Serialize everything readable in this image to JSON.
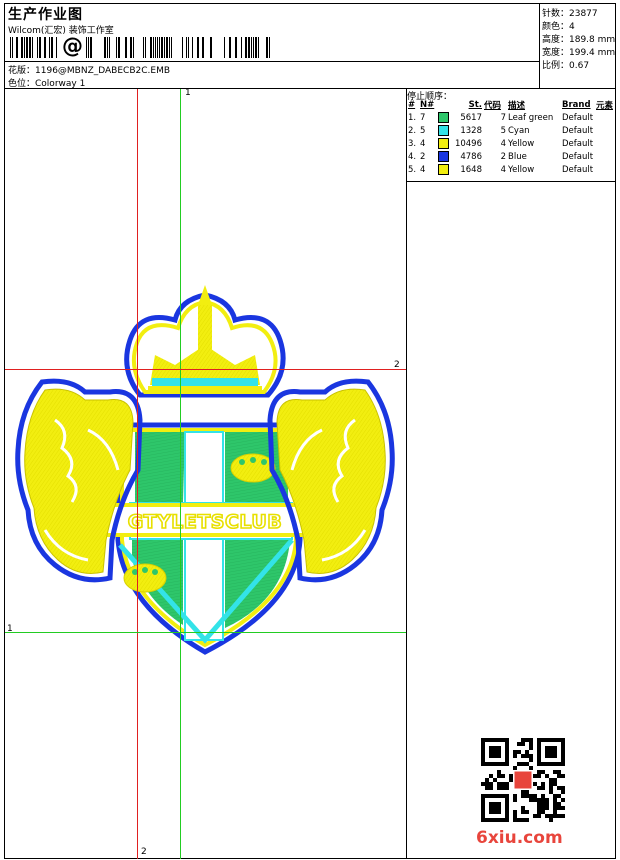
{
  "header": {
    "title": "生产作业图",
    "subtitle": "Wilcom(汇宏) 装饰工作室",
    "barcode_char": "@",
    "design_label": "花版：",
    "design_file": "1196@MBNZ_DABECB2C.EMB",
    "colorway_label": "色位：",
    "colorway": "Colorway 1"
  },
  "stats": {
    "stitches": "针数：23877",
    "colors": "颜色：4",
    "height": "高度：189.8 mm",
    "width": "宽度：199.4 mm",
    "scale": "比例：0.67"
  },
  "stops": {
    "title": "停止顺序：",
    "headers": [
      "#",
      "N#",
      "St.",
      "代码",
      "描述",
      "Brand",
      "元素"
    ],
    "rows": [
      {
        "idx": "1.",
        "n": "7",
        "color": "#2ec66a",
        "st": "5617",
        "code": "7",
        "desc": "Leaf green",
        "brand": "Default"
      },
      {
        "idx": "2.",
        "n": "5",
        "color": "#33e3e8",
        "st": "1328",
        "code": "5",
        "desc": "Cyan",
        "brand": "Default"
      },
      {
        "idx": "3.",
        "n": "4",
        "color": "#f2ee10",
        "st": "10496",
        "code": "4",
        "desc": "Yellow",
        "brand": "Default"
      },
      {
        "idx": "4.",
        "n": "2",
        "color": "#1a36e0",
        "st": "4786",
        "code": "2",
        "desc": "Blue",
        "brand": "Default"
      },
      {
        "idx": "5.",
        "n": "4",
        "color": "#f2ee10",
        "st": "1648",
        "code": "4",
        "desc": "Yellow",
        "brand": "Default"
      }
    ]
  },
  "grid": {
    "label_v_green": "1",
    "label_h_red": "2",
    "label_h_green": "1",
    "label_v_red": "2"
  },
  "design": {
    "banner_text": "GTYLETSCLUB"
  },
  "watermark": "6xiu.com",
  "colors": {
    "leaf_green": "#2ec66a",
    "cyan": "#33e3e8",
    "yellow": "#f2ee10",
    "blue": "#1a36e0",
    "grid_red": "#e02020",
    "grid_green": "#22cc22",
    "watermark_red": "#e8453c"
  }
}
